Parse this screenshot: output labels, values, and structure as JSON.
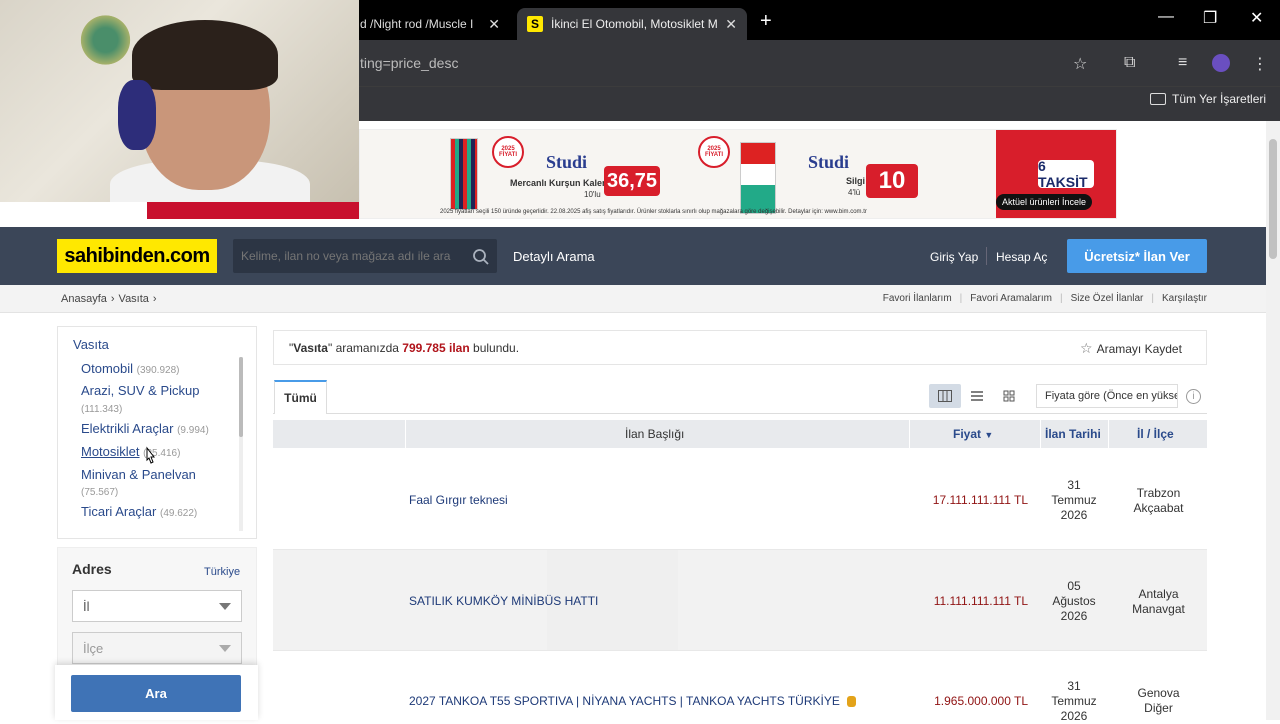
{
  "browser": {
    "tabs": [
      {
        "label": "d /Night rod /Muscle I",
        "active": false
      },
      {
        "label": "İkinci El Otomobil, Motosiklet M",
        "active": true
      }
    ],
    "url": "ting=price_desc",
    "bookmarks_label": "Tüm Yer İşaretleri"
  },
  "banner": {
    "product1_brand": "Studi",
    "product1_desc": "Mercanlı Kurşun Kalem",
    "product1_count": "10'lu",
    "product1_price": "36,75",
    "product2_brand": "Studi",
    "product2_desc": "Silgi",
    "product2_count": "4'lü",
    "product2_price": "10",
    "badge": "2025 FİYATI",
    "taksit": "6 TAKSİT",
    "cta": "Aktüel ürünleri İncele",
    "fineprint": "2025 fiyatları seçili 150 üründe geçerlidir. 22.08.2025 afiş satış fiyatlarıdır. Ürünler stoklarla sınırlı olup mağazalara göre değişebilir. Detaylar için: www.bim.com.tr"
  },
  "header": {
    "logo": "sahibinden.com",
    "search_placeholder": "Kelime, ilan no veya mağaza adı ile ara",
    "detailed_search": "Detaylı Arama",
    "login": "Giriş Yap",
    "register": "Hesap Aç",
    "post_ad": "Ücretsiz* İlan Ver"
  },
  "breadcrumb": [
    "Anasayfa",
    "Vasıta"
  ],
  "quick_links": [
    "Favori İlanlarım",
    "Favori Aramalarım",
    "Size Özel İlanlar",
    "Karşılaştır"
  ],
  "sidebar": {
    "category_title": "Vasıta",
    "categories": [
      {
        "label": "Otomobil",
        "count": "(390.928)"
      },
      {
        "label": "Arazi, SUV & Pickup",
        "count": "(111.343)"
      },
      {
        "label": "Elektrikli Araçlar",
        "count": "(9.994)"
      },
      {
        "label": "Motosiklet",
        "count": "(25.416)"
      },
      {
        "label": "Minivan & Panelvan",
        "count": "(75.567)"
      },
      {
        "label": "Ticari Araçlar",
        "count": "(49.622)"
      }
    ],
    "address_title": "Adres",
    "country": "Türkiye",
    "province_placeholder": "İl",
    "district_placeholder": "İlçe",
    "search_button": "Ara"
  },
  "results": {
    "query": "Vasıta",
    "text_mid": "aramanızda",
    "count": "799.785 ilan",
    "text_end": "bulundu.",
    "save_search": "Aramayı Kaydet",
    "tab_all": "Tümü",
    "sort_label": "Fiyata göre (Önce en yüksek)",
    "columns": {
      "title": "İlan Başlığı",
      "price": "Fiyat",
      "date": "İlan Tarihi",
      "location": "İl / İlçe"
    },
    "rows": [
      {
        "title": "Faal Gırgır teknesi",
        "price": "17.111.111.111 TL",
        "date_day": "31",
        "date_month": "Temmuz",
        "date_year": "2026",
        "city": "Trabzon",
        "district": "Akçaabat"
      },
      {
        "title": "SATILIK KUMKÖY MİNİBÜS HATTI",
        "price": "11.111.111.111 TL",
        "date_day": "05",
        "date_month": "Ağustos",
        "date_year": "2026",
        "city": "Antalya",
        "district": "Manavgat"
      },
      {
        "title": "2027 TANKOA T55 SPORTIVA | NİYANA YACHTS | TANKOA YACHTS TÜRKİYE",
        "price": "1.965.000.000 TL",
        "date_day": "31",
        "date_month": "Temmuz",
        "date_year": "2026",
        "city": "Genova",
        "district": "Diğer"
      }
    ]
  },
  "colors": {
    "header_bg": "#3b4658",
    "logo_bg": "#ffe800",
    "cta_blue": "#489be8",
    "price_red": "#901313",
    "link_blue": "#1e3a78"
  }
}
